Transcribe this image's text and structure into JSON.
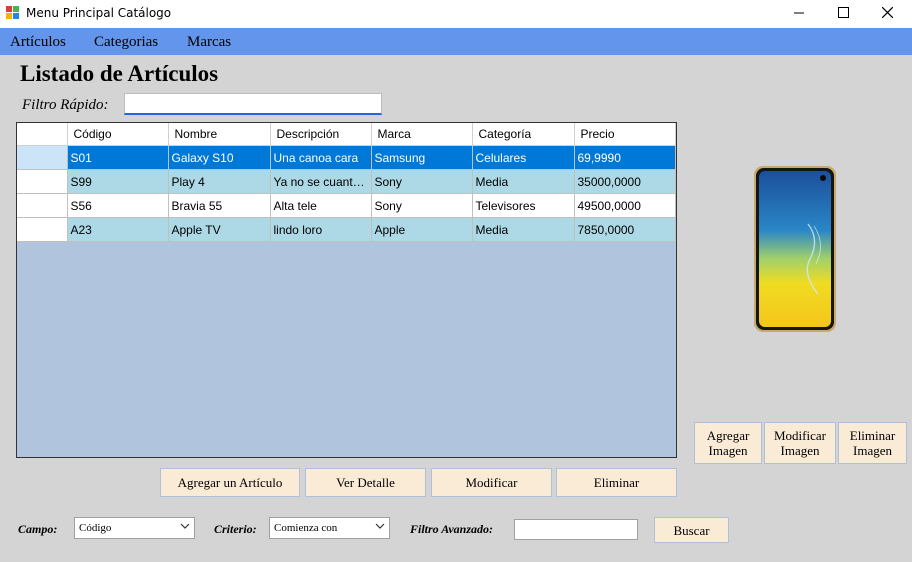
{
  "window": {
    "title": "Menu Principal Catálogo",
    "controls": {
      "minimize": "minimize-icon",
      "maximize": "maximize-icon",
      "close": "close-icon"
    }
  },
  "menu": {
    "items": [
      "Artículos",
      "Categorias",
      "Marcas"
    ]
  },
  "page": {
    "heading": "Listado de Artículos",
    "quick_filter_label": "Filtro Rápido:",
    "quick_filter_value": ""
  },
  "grid": {
    "columns": [
      "Código",
      "Nombre",
      "Descripción",
      "Marca",
      "Categoría",
      "Precio"
    ],
    "rows": [
      {
        "codigo": "S01",
        "nombre": "Galaxy S10",
        "descripcion": "Una canoa cara",
        "marca": "Samsung",
        "categoria": "Celulares",
        "precio": "69,9990"
      },
      {
        "codigo": "S99",
        "nombre": "Play 4",
        "descripcion": "Ya no se cuantas...",
        "marca": "Sony",
        "categoria": "Media",
        "precio": "35000,0000"
      },
      {
        "codigo": "S56",
        "nombre": "Bravia 55",
        "descripcion": "Alta tele",
        "marca": "Sony",
        "categoria": "Televisores",
        "precio": "49500,0000"
      },
      {
        "codigo": "A23",
        "nombre": "Apple TV",
        "descripcion": "lindo loro",
        "marca": "Apple",
        "categoria": "Media",
        "precio": "7850,0000"
      }
    ]
  },
  "actions": {
    "add": "Agregar un Artículo",
    "detail": "Ver Detalle",
    "modify": "Modificar",
    "delete": "Eliminar"
  },
  "image_actions": {
    "add_line1": "Agregar",
    "add_line2": "Imagen",
    "modify_line1": "Modificar",
    "modify_line2": "Imagen",
    "delete_line1": "Eliminar",
    "delete_line2": "Imagen"
  },
  "advanced_filter": {
    "field_label": "Campo:",
    "field_value": "Código",
    "criteria_label": "Criterio:",
    "criteria_value": "Comienza con",
    "filter_label": "Filtro Avanzado:",
    "filter_value": "",
    "search_button": "Buscar"
  },
  "colors": {
    "menubar": "#6495ed",
    "selection": "#0078d7",
    "alt_row": "#add8e6",
    "grid_background": "#b0c4de",
    "button_fill": "#faebd7"
  },
  "image": {
    "subject": "phone-image"
  }
}
